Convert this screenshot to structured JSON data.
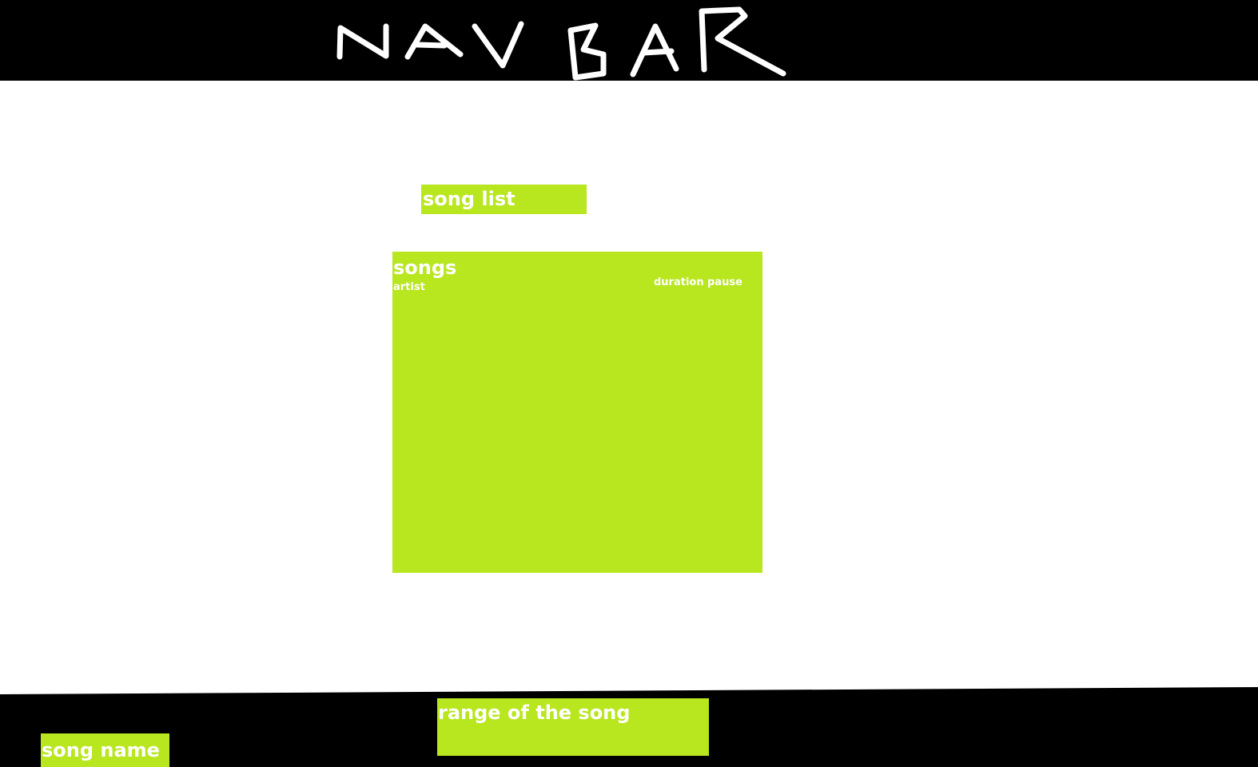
{
  "navbar": {
    "logo_text": "NAV BAR",
    "background_color": "#000000",
    "logo_color": "#ffffff"
  },
  "song_list": {
    "label": "song list"
  },
  "songs_panel": {
    "title": "songs",
    "artist_label": "artist",
    "duration_label": "duration",
    "pause_label": "pause"
  },
  "player": {
    "range_label": "range of the song",
    "song_name_label": "song name"
  },
  "colors": {
    "accent": "#b8e61f",
    "text": "#ffffff",
    "page_background": "#ffffff",
    "bar_background": "#000000"
  }
}
